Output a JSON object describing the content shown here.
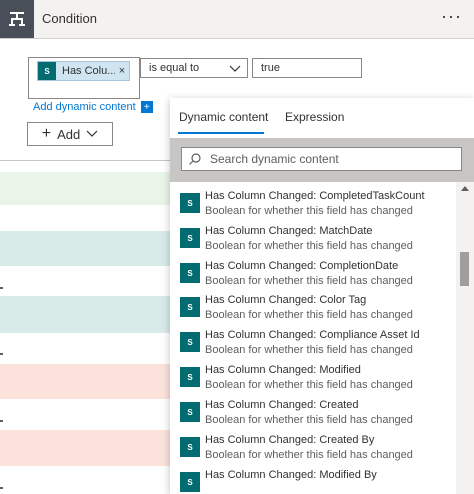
{
  "header": {
    "title": "Condition",
    "more": "···"
  },
  "condition": {
    "token_label": "Has Colu...",
    "token_icon": "S",
    "token_close": "×",
    "operator": "is equal to",
    "value": "true"
  },
  "add_dynamic": {
    "label": "Add dynamic content",
    "plus": "+"
  },
  "add_button": {
    "label": "Add"
  },
  "flyout": {
    "tabs": [
      {
        "label": "Dynamic content",
        "active": true
      },
      {
        "label": "Expression",
        "active": false
      }
    ],
    "search": {
      "placeholder": "Search dynamic content"
    },
    "items": [
      {
        "name": "Has Column Changed: CompletedTaskCount",
        "desc": "Boolean for whether this field has changed"
      },
      {
        "name": "Has Column Changed: MatchDate",
        "desc": "Boolean for whether this field has changed"
      },
      {
        "name": "Has Column Changed: CompletionDate",
        "desc": "Boolean for whether this field has changed"
      },
      {
        "name": "Has Column Changed: Color Tag",
        "desc": "Boolean for whether this field has changed"
      },
      {
        "name": "Has Column Changed: Compliance Asset Id",
        "desc": "Boolean for whether this field has changed"
      },
      {
        "name": "Has Column Changed: Modified",
        "desc": "Boolean for whether this field has changed"
      },
      {
        "name": "Has Column Changed: Created",
        "desc": "Boolean for whether this field has changed"
      },
      {
        "name": "Has Column Changed: Created By",
        "desc": "Boolean for whether this field has changed"
      },
      {
        "name": "Has Column Changed: Modified By",
        "desc": ""
      }
    ],
    "item_icon": "S"
  },
  "colors": {
    "accent": "#0078d4",
    "sharepoint": "#036c70",
    "stripe_green": "#eaf5ea",
    "stripe_teal": "#d9ebe9",
    "stripe_red": "#fbe3dc"
  }
}
